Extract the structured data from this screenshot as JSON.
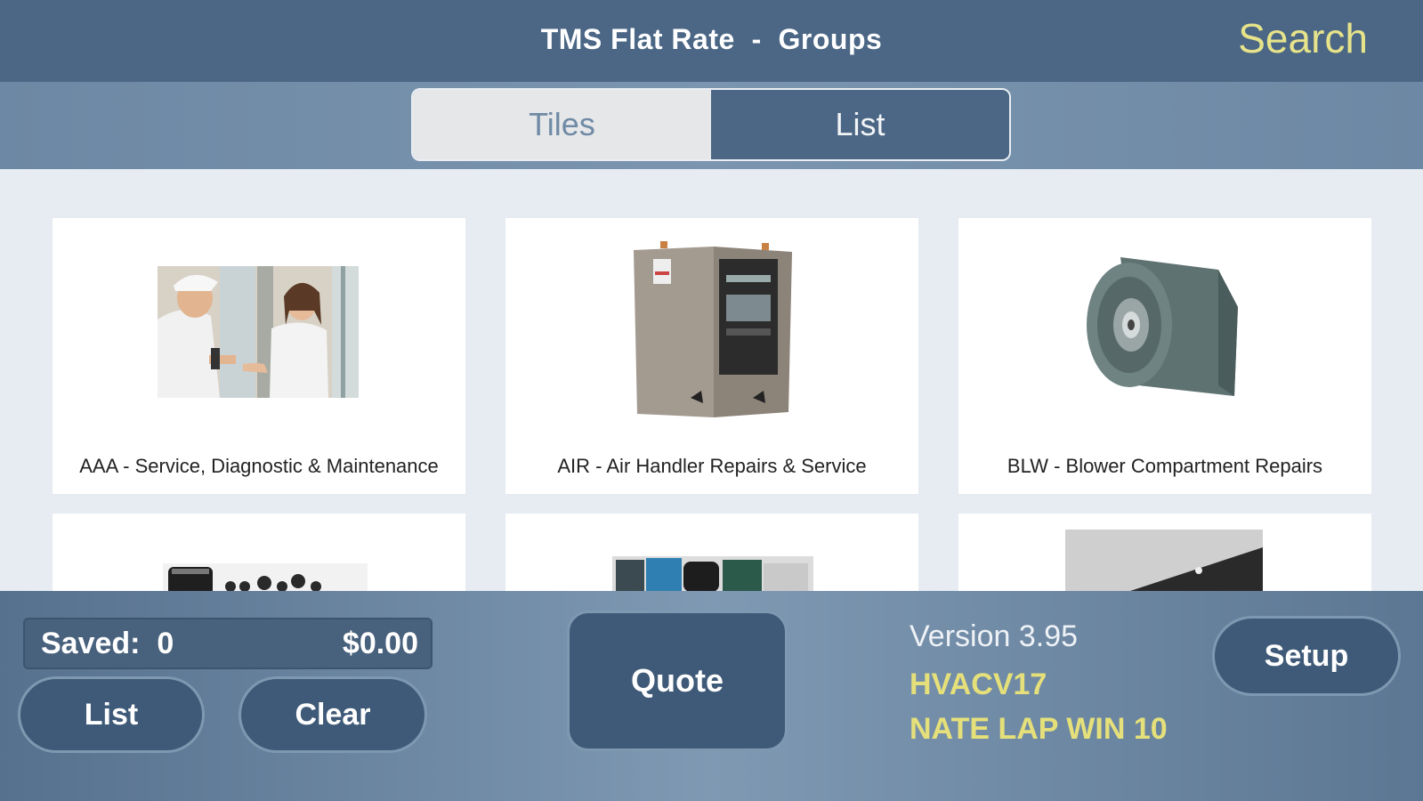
{
  "header": {
    "title": "TMS Flat Rate  -  Groups",
    "search_label": "Search"
  },
  "view_toggle": {
    "tiles_label": "Tiles",
    "list_label": "List",
    "selected": "List"
  },
  "groups": [
    {
      "label": "AAA - Service, Diagnostic & Maintenance",
      "image": "technician-greeting-customer"
    },
    {
      "label": "AIR - Air Handler Repairs & Service",
      "image": "air-handler-unit"
    },
    {
      "label": "BLW - Blower Compartment Repairs",
      "image": "blower-motor"
    },
    {
      "label": "",
      "image": "capacitors"
    },
    {
      "label": "",
      "image": "compressors"
    },
    {
      "label": "",
      "image": "coil-panel"
    }
  ],
  "footer": {
    "saved_label": "Saved:  0",
    "saved_amount": "$0.00",
    "list_button": "List",
    "clear_button": "Clear",
    "quote_button": "Quote",
    "version": "Version 3.95",
    "db_code": "HVACV17",
    "device_name": "NATE LAP WIN 10",
    "setup_button": "Setup"
  },
  "colors": {
    "header_bg": "#4b6785",
    "accent_yellow": "#e7e38a",
    "button_bg": "#3f5a78"
  }
}
